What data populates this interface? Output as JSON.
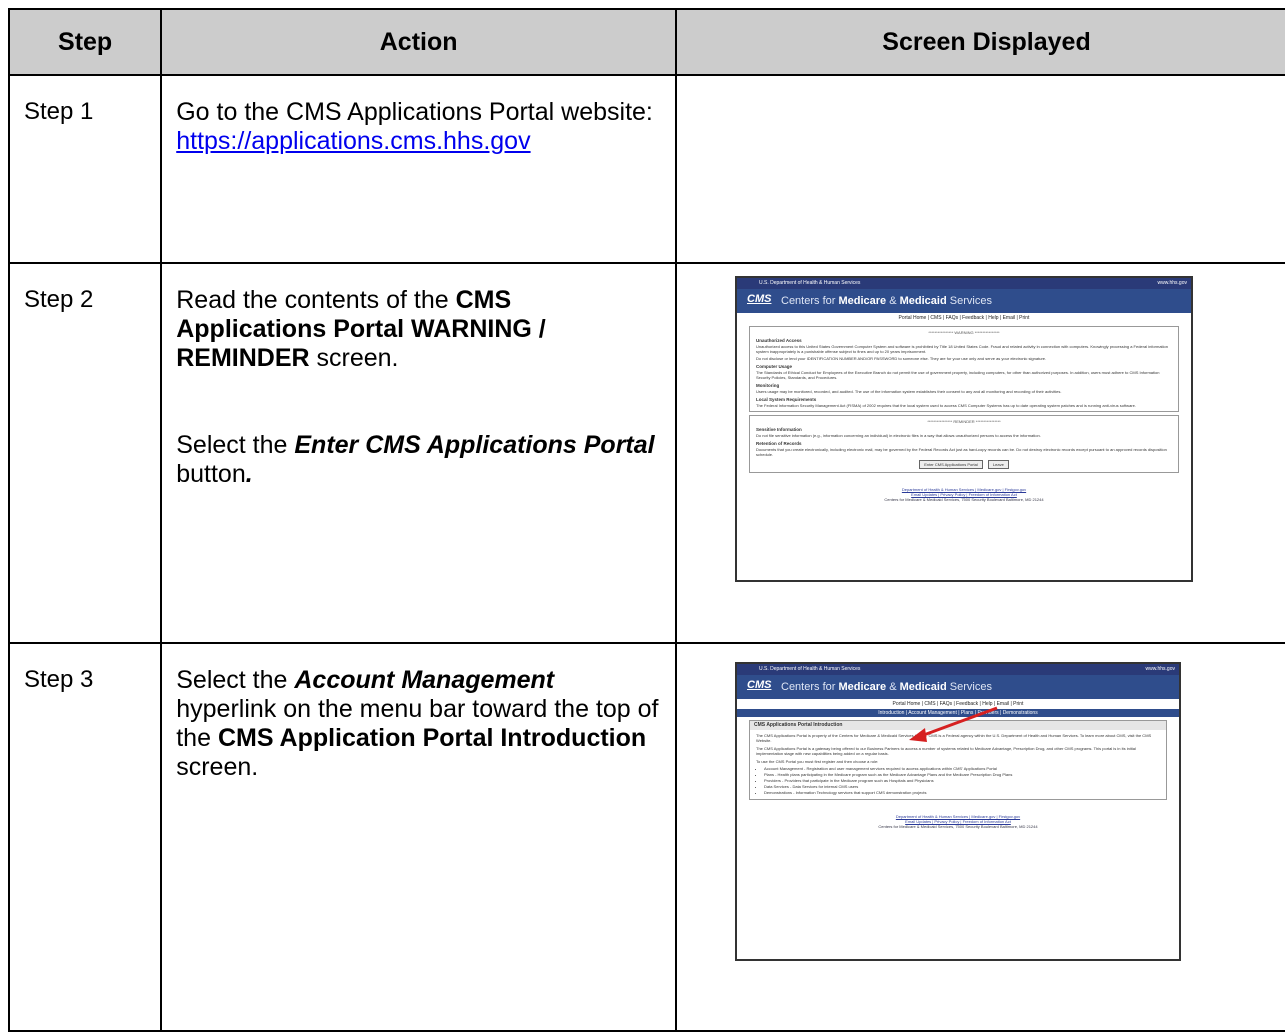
{
  "header": {
    "step": "Step",
    "action": "Action",
    "screen": "Screen Displayed"
  },
  "rows": [
    {
      "step": "Step 1",
      "line1": "Go to the CMS Applications Portal website:",
      "url": "https://applications.cms.hhs.gov"
    },
    {
      "step": "Step 2",
      "p1_pre": "Read the contents of the ",
      "p1_bold": "CMS Applications Portal WARNING / REMINDER",
      "p1_post": " screen.",
      "p2_pre": "Select the ",
      "p2_bi": "Enter CMS Applications Portal",
      "p2_post": " button",
      "p2_end": "."
    },
    {
      "step": "Step 3",
      "pre": "Select the ",
      "bi": "Account Management",
      "mid": " hyperlink on the menu bar toward the top of the ",
      "bold": "CMS Application Portal Introduction",
      "post": " screen."
    }
  ],
  "shot": {
    "hhs": "U.S. Department of Health & Human Services",
    "hhs_url": "www.hhs.gov",
    "logo": "CMS",
    "center_pre": "Centers for ",
    "center_b1": "Medicare",
    "center_amp": " & ",
    "center_b2": "Medicaid",
    "center_post": " Services",
    "nav": "Portal Home | CMS | FAQs | Feedback | Help | Email | Print",
    "subnav": "Introduction | Account Management | Plans | Providers | Demonstrations",
    "warn_hdr": "**************** WARNING ****************",
    "warn_h1": "Unauthorized Access",
    "warn_t1": "Unauthorized access to this United States Government Computer System and software is prohibited by Title 18 United States Code. Fraud and related activity in connection with computers. Knowingly processing a Federal information system inappropriately is a punishable offense subject to fines and up to 20 years imprisonment.",
    "warn_t1b": "Do not disclose or lend your IDENTIFICATION NUMBER AND/OR PASSWORD to someone else. They are for your use only and serve as your electronic signature.",
    "warn_h2": "Computer Usage",
    "warn_t2": "The Standards of Ethical Conduct for Employees of the Executive Branch do not permit the use of government property, including computers, for other than authorized purposes. In addition, users must adhere to CMS Information Security Policies, Standards, and Procedures.",
    "warn_h3": "Monitoring",
    "warn_t3": "Users usage may be monitored, recorded, and audited. The use of the information system establishes their consent to any and all monitoring and recording of their activities.",
    "warn_h4": "Local System Requirements",
    "warn_t4": "The Federal Information Security Management Act (FISMA) of 2002 requires that the local system used to access CMS Computer Systems has up to date operating system patches and is running anti-virus software.",
    "rem_hdr": "**************** REMINDER ****************",
    "rem_h1": "Sensitive Information",
    "rem_t1": "Do not file sensitive information (e.g., information concerning an individual) in electronic files in a way that allows unauthorized persons to access the information.",
    "rem_h2": "Retention of Records",
    "rem_t2": "Documents that you create electronically, including electronic mail, may be governed by the Federal Records Act just as hard-copy records can be. Do not destroy electronic records except pursuant to an approved records disposition schedule.",
    "btn_enter": "Enter CMS Applications Portal",
    "btn_leave": "Leave",
    "foot1": "Department of Health & Human Services | Medicare.gov | Firstgov.gov",
    "foot2": "Email Updates | Privacy Policy | Freedom of Information Act",
    "foot3": "Centers for Medicare & Medicaid Services, 7500 Security Boulevard Baltimore, MD 21244",
    "intro_title": "CMS Applications Portal Introduction",
    "intro_p1": "The CMS Applications Portal is property of the Centers for Medicare & Medicaid Services (CMS). CMS is a Federal agency within the U.S. Department of Health and Human Services. To learn more about CMS, visit the CMS Website.",
    "intro_p2": "The CMS Applications Portal is a gateway being offered to our Business Partners to access a number of systems related to Medicare Advantage, Prescription Drug, and other CMS programs. This portal is in its initial implementation stage with new capabilities being added on a regular basis.",
    "intro_p3": "To use the CMS Portal you must first register and then choose a role:",
    "intro_li1": "Account Management - Registration and user management services required to access applications within CMS' Applications Portal",
    "intro_li2": "Plans - Health plans participating in the Medicare program such as the Medicare Advantage Plans and the Medicare Prescription Drug Plans",
    "intro_li3": "Providers - Providers that participate in the Medicare program such as Hospitals and Physicians",
    "intro_li4": "Data Services - Data Services for internal CMS users",
    "intro_li5": "Demonstrations - Information Technology services that support CMS demonstration projects",
    "arrow_color": "#d62020"
  }
}
